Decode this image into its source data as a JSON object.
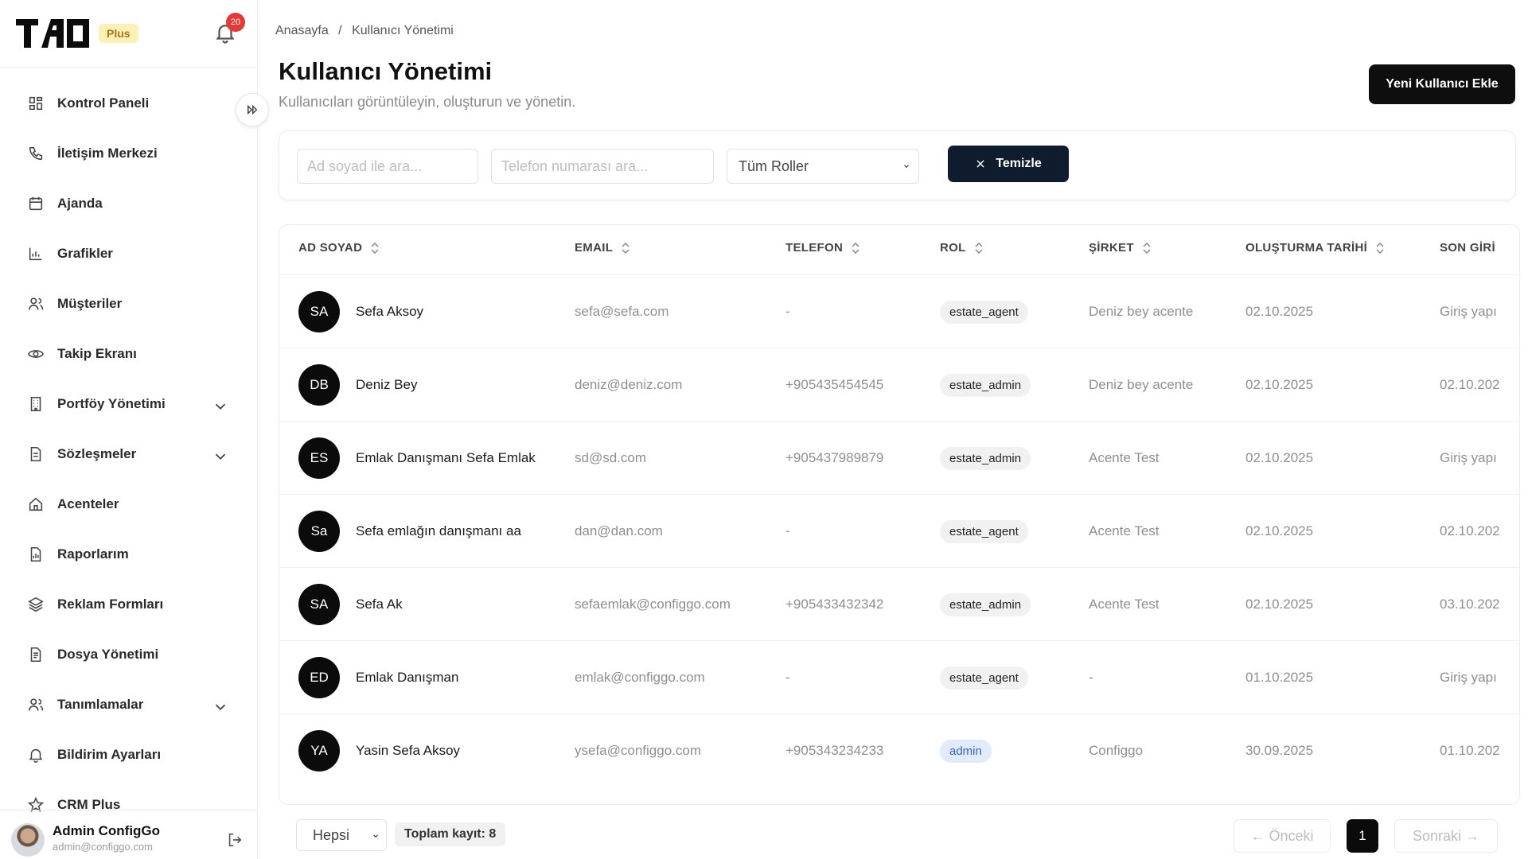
{
  "brand": {
    "logo_text": "TAO",
    "plan_badge": "Plus",
    "notification_count": "20"
  },
  "sidebar": {
    "items": [
      {
        "label": "Kontrol Paneli",
        "icon": "dashboard-icon"
      },
      {
        "label": "İletişim Merkezi",
        "icon": "phone-icon"
      },
      {
        "label": "Ajanda",
        "icon": "calendar-icon"
      },
      {
        "label": "Grafikler",
        "icon": "chart-icon"
      },
      {
        "label": "Müşteriler",
        "icon": "users-icon"
      },
      {
        "label": "Takip Ekranı",
        "icon": "eye-icon"
      },
      {
        "label": "Portföy Yönetimi",
        "icon": "building-icon",
        "expandable": true
      },
      {
        "label": "Sözleşmeler",
        "icon": "document-icon",
        "expandable": true
      },
      {
        "label": "Acenteler",
        "icon": "home-icon"
      },
      {
        "label": "Raporlarım",
        "icon": "report-icon"
      },
      {
        "label": "Reklam Formları",
        "icon": "layers-icon"
      },
      {
        "label": "Dosya Yönetimi",
        "icon": "file-icon"
      },
      {
        "label": "Tanımlamalar",
        "icon": "users-icon",
        "expandable": true
      },
      {
        "label": "Bildirim Ayarları",
        "icon": "bell-icon"
      },
      {
        "label": "CRM Plus",
        "icon": "star-icon"
      }
    ],
    "user": {
      "name": "Admin ConfigGo",
      "email": "admin@configgo.com"
    }
  },
  "breadcrumb": {
    "home": "Anasayfa",
    "separator": "/",
    "current": "Kullanıcı Yönetimi"
  },
  "header": {
    "title": "Kullanıcı Yönetimi",
    "subtitle": "Kullanıcıları görüntüleyin, oluşturun ve yönetin.",
    "add_button": "Yeni Kullanıcı Ekle"
  },
  "filters": {
    "name_placeholder": "Ad soyad ile ara...",
    "phone_placeholder": "Telefon numarası ara...",
    "role_select": "Tüm Roller",
    "clear_button": "Temizle"
  },
  "table": {
    "columns": [
      "AD SOYAD",
      "EMAIL",
      "TELEFON",
      "ROL",
      "ŞİRKET",
      "OLUŞTURMA TARİHİ",
      "SON GİRİ"
    ],
    "rows": [
      {
        "initials": "SA",
        "name": "Sefa Aksoy",
        "email": "sefa@sefa.com",
        "phone": "-",
        "role": "estate_agent",
        "company": "Deniz bey acente",
        "created": "02.10.2025",
        "last_login": "Giriş yapı"
      },
      {
        "initials": "DB",
        "name": "Deniz Bey",
        "email": "deniz@deniz.com",
        "phone": "+905435454545",
        "role": "estate_admin",
        "company": "Deniz bey acente",
        "created": "02.10.2025",
        "last_login": "02.10.202"
      },
      {
        "initials": "ES",
        "name": "Emlak Danışmanı Sefa Emlak",
        "email": "sd@sd.com",
        "phone": "+905437989879",
        "role": "estate_admin",
        "company": "Acente Test",
        "created": "02.10.2025",
        "last_login": "Giriş yapı"
      },
      {
        "initials": "Sa",
        "name": "Sefa emlağın danışmanı aa",
        "email": "dan@dan.com",
        "phone": "-",
        "role": "estate_agent",
        "company": "Acente Test",
        "created": "02.10.2025",
        "last_login": "02.10.202"
      },
      {
        "initials": "SA",
        "name": "Sefa Ak",
        "email": "sefaemlak@configgo.com",
        "phone": "+905433432342",
        "role": "estate_admin",
        "company": "Acente Test",
        "created": "02.10.2025",
        "last_login": "03.10.202"
      },
      {
        "initials": "ED",
        "name": "Emlak Danışman",
        "email": "emlak@configgo.com",
        "phone": "-",
        "role": "estate_agent",
        "company": "-",
        "created": "01.10.2025",
        "last_login": "Giriş yapı"
      },
      {
        "initials": "YA",
        "name": "Yasin Sefa Aksoy",
        "email": "ysefa@configgo.com",
        "phone": "+905343234233",
        "role": "admin",
        "company": "Configgo",
        "created": "30.09.2025",
        "last_login": "01.10.202"
      }
    ]
  },
  "pagination": {
    "per_page": "Hepsi",
    "total": "Toplam kayıt: 8",
    "prev": "← Önceki",
    "current_page": "1",
    "next": "Sonraki →"
  },
  "colors": {
    "primary": "#0b0b0b",
    "clear_button": "#0f1c2e",
    "admin_badge_bg": "#e2ebfb",
    "admin_badge_text": "#3567c8",
    "plus_badge": "#fdf0b6",
    "notification": "#e53935"
  }
}
